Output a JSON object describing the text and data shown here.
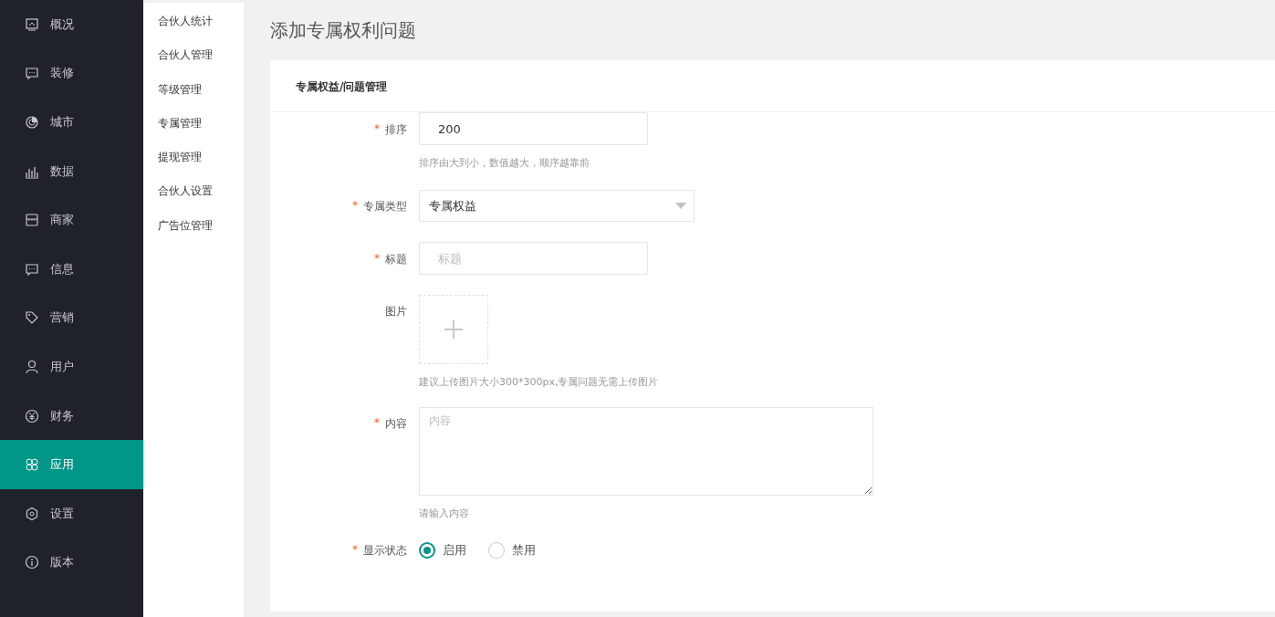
{
  "sidebar": {
    "items": [
      {
        "label": "概况",
        "selected": false
      },
      {
        "label": "装修",
        "selected": false
      },
      {
        "label": "城市",
        "selected": false
      },
      {
        "label": "数据",
        "selected": false
      },
      {
        "label": "商家",
        "selected": false
      },
      {
        "label": "信息",
        "selected": false
      },
      {
        "label": "营销",
        "selected": false
      },
      {
        "label": "用户",
        "selected": false
      },
      {
        "label": "财务",
        "selected": false
      },
      {
        "label": "应用",
        "selected": true
      },
      {
        "label": "设置",
        "selected": false
      },
      {
        "label": "版本",
        "selected": false
      }
    ]
  },
  "submenu": {
    "items": [
      {
        "label": "合伙人统计"
      },
      {
        "label": "合伙人管理"
      },
      {
        "label": "等级管理"
      },
      {
        "label": "专属管理"
      },
      {
        "label": "提现管理"
      },
      {
        "label": "合伙人设置"
      },
      {
        "label": "广告位管理"
      }
    ]
  },
  "page_title": "添加专属权利问题",
  "card": {
    "title": "专属权益/问题管理",
    "fields": [
      {
        "kind": "input",
        "required_mark": "*",
        "label": "排序",
        "value": "200",
        "help": "排序由大到小，数值越大，顺序越靠前"
      },
      {
        "kind": "select",
        "required_mark": "*",
        "label": "专属类型",
        "value": "专属权益"
      },
      {
        "kind": "input",
        "required_mark": "*",
        "label": "标题",
        "placeholder": "标题"
      },
      {
        "kind": "upload",
        "label": "图片",
        "help": "建议上传图片大小300*300px,专属问题无需上传图片"
      },
      {
        "kind": "textarea",
        "required_mark": "*",
        "label": "内容",
        "placeholder": "内容",
        "help": "请输入内容"
      },
      {
        "kind": "radio",
        "required_mark": "*",
        "label": "显示状态",
        "options": [
          {
            "label": "启用",
            "selected": true
          },
          {
            "label": "禁用",
            "selected": false
          }
        ]
      }
    ]
  }
}
